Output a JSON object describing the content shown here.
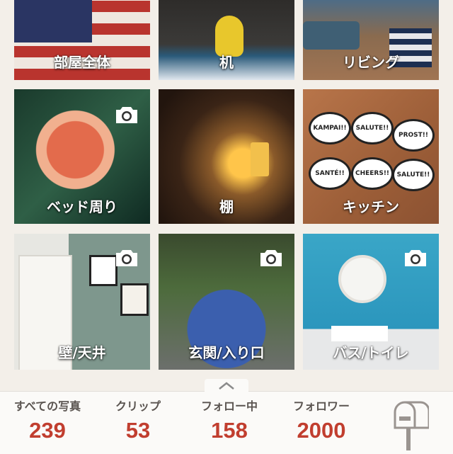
{
  "tiles": [
    {
      "label": "部屋全体"
    },
    {
      "label": "机"
    },
    {
      "label": "リビング"
    },
    {
      "label": "ベッド周り"
    },
    {
      "label": "棚"
    },
    {
      "label": "キッチン"
    },
    {
      "label": "壁/天井"
    },
    {
      "label": "玄関/入り口"
    },
    {
      "label": "バス/トイレ"
    }
  ],
  "kitchen_bubbles": [
    "KAMPAI!!",
    "SALUTE!!",
    "PROST!!",
    "SANTÉ!!",
    "CHEERS!!",
    "SALUTE!!"
  ],
  "stats": [
    {
      "title": "すべての写真",
      "count": "239"
    },
    {
      "title": "クリップ",
      "count": "53"
    },
    {
      "title": "フォロー中",
      "count": "158"
    },
    {
      "title": "フォロワー",
      "count": "2000"
    }
  ],
  "icons": {
    "camera": "camera-icon",
    "chevron": "chevron-up-icon",
    "mailbox": "mailbox-icon"
  },
  "colors": {
    "accent": "#c13e2f",
    "background": "#f3efe9"
  }
}
